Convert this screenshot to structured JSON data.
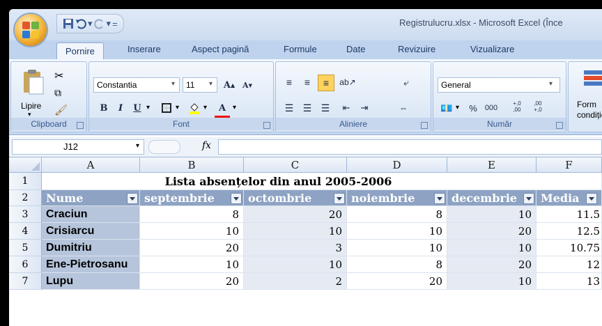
{
  "window": {
    "title": "Registrulucru.xlsx - Microsoft Excel (Înce"
  },
  "qat": {
    "save": "save-icon",
    "undo": "undo-icon",
    "redo": "redo-icon",
    "customize": "="
  },
  "tabs": [
    "Pornire",
    "Inserare",
    "Aspect pagină",
    "Formule",
    "Date",
    "Revizuire",
    "Vizualizare"
  ],
  "ribbon": {
    "clipboard": {
      "label": "Clipboard",
      "paste": "Lipire"
    },
    "font": {
      "label": "Font",
      "font_name": "Constantia",
      "font_size": "11",
      "bold": "B",
      "italic": "I",
      "underline": "U",
      "grow": "A",
      "shrink": "A"
    },
    "alignment": {
      "label": "Aliniere"
    },
    "number": {
      "label": "Număr",
      "format": "General",
      "percent": "%",
      "thousands": "000",
      "inc_decimal": "+,0\n,00",
      "dec_decimal": ",00\n+,0"
    },
    "styles": {
      "label": "Form\ncondiție"
    }
  },
  "formula_bar": {
    "cell_ref": "J12",
    "fx": "fx",
    "content": ""
  },
  "sheet": {
    "columns": [
      "A",
      "B",
      "C",
      "D",
      "E",
      "F"
    ],
    "rows": [
      "1",
      "2",
      "3",
      "4",
      "5",
      "6",
      "7"
    ],
    "title": "Lista absențelor din anul 2005-2006",
    "headers": [
      "Nume",
      "septembrie",
      "octombrie",
      "noiembrie",
      "decembrie",
      "Media"
    ],
    "data": [
      [
        "Craciun",
        "8",
        "20",
        "8",
        "10",
        "11.5"
      ],
      [
        "Crisiarcu",
        "10",
        "10",
        "10",
        "20",
        "12.5"
      ],
      [
        "Dumitriu",
        "20",
        "3",
        "10",
        "10",
        "10.75"
      ],
      [
        "Ene-Pietrosanu",
        "10",
        "10",
        "8",
        "20",
        "12"
      ],
      [
        "Lupu",
        "20",
        "2",
        "20",
        "10",
        "13"
      ]
    ]
  }
}
